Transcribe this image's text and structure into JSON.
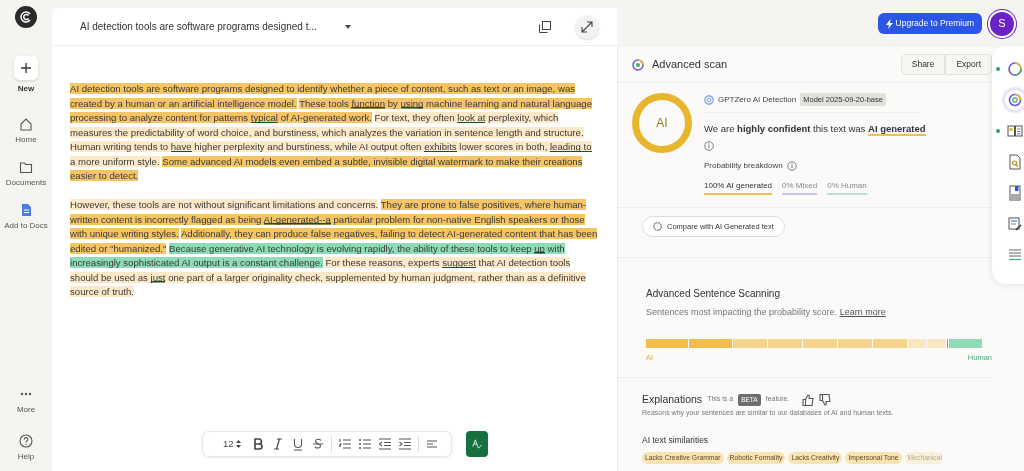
{
  "sidebar": {
    "new_label": "New",
    "items": [
      {
        "label": "Home",
        "kind": "home"
      },
      {
        "label": "Documents",
        "kind": "folder"
      },
      {
        "label": "Add to Docs",
        "kind": "doc"
      }
    ],
    "bottom_items": [
      {
        "label": "More",
        "kind": "more"
      },
      {
        "label": "Help",
        "kind": "help"
      }
    ]
  },
  "editor": {
    "title": "AI detection tools are software programs designed t...",
    "paragraphs": [
      [
        {
          "kind": "strong",
          "parts": [
            {
              "text": "AI detection tools are software programs designed to identify whether a piece of content, such as text or an image, was created by a human or an artificial intelligence model.",
              "underlined": false
            }
          ]
        },
        {
          "kind": "strong",
          "parts": [
            {
              "text": "These tools ",
              "underlined": false
            },
            {
              "text": "function",
              "underlined": true
            },
            {
              "text": " by ",
              "underlined": false
            },
            {
              "text": "using",
              "underlined": true
            },
            {
              "text": " machine learning and natural language processing to analyze content for patterns ",
              "underlined": false
            },
            {
              "text": "typical",
              "underlined": true
            },
            {
              "text": " of AI-generated work.",
              "underlined": false
            }
          ]
        },
        {
          "kind": "light",
          "parts": [
            {
              "text": "For text, they often ",
              "underlined": false
            },
            {
              "text": "look at",
              "underlined": true
            },
            {
              "text": " perplexity, which measures the predictability of word choice, and burstiness, which analyzes the variation in sentence length and structure.",
              "underlined": false
            }
          ]
        },
        {
          "kind": "light",
          "parts": [
            {
              "text": "Human writing tends to ",
              "underlined": false
            },
            {
              "text": "have",
              "underlined": true
            },
            {
              "text": " higher perplexity and burstiness, while AI output often ",
              "underlined": false
            },
            {
              "text": "exhibits",
              "underlined": true
            },
            {
              "text": " lower scores in both, ",
              "underlined": false
            },
            {
              "text": "leading to",
              "underlined": true
            },
            {
              "text": " a more uniform style.",
              "underlined": false
            }
          ]
        },
        {
          "kind": "strong",
          "parts": [
            {
              "text": "Some advanced AI models even embed a subtle, invisible digital watermark to make their creations easier to detect.",
              "underlined": false
            }
          ]
        }
      ],
      [
        {
          "kind": "light",
          "parts": [
            {
              "text": "However, these tools are not without significant limitations and concerns.",
              "underlined": false
            }
          ]
        },
        {
          "kind": "strong",
          "parts": [
            {
              "text": "They are prone to false positives, where human-written content is incorrectly flagged as being ",
              "underlined": false
            },
            {
              "text": "AI-generated--a",
              "underlined": true
            },
            {
              "text": " particular problem for non-native English speakers or those with unique writing styles.",
              "underlined": false
            }
          ]
        },
        {
          "kind": "strong",
          "parts": [
            {
              "text": "Additionally, they can produce false negatives, failing to detect AI-generated content that has been edited or \"humanized.\"",
              "underlined": false
            }
          ]
        },
        {
          "kind": "human",
          "parts": [
            {
              "text": "Because generative AI technology is evolving rapidly, the ability of these tools to keep ",
              "underlined": false
            },
            {
              "text": "up",
              "underlined": true
            },
            {
              "text": " with increasingly sophisticated AI output is a constant challenge.",
              "underlined": false
            }
          ]
        },
        {
          "kind": "light",
          "parts": [
            {
              "text": "For these reasons, experts ",
              "underlined": false
            },
            {
              "text": "suggest",
              "underlined": true
            },
            {
              "text": " that AI detection tools should be used as ",
              "underlined": false
            },
            {
              "text": "just",
              "underlined": true
            },
            {
              "text": " one part of a larger originality check, supplemented by human judgment, rather than as a definitive source of truth.",
              "underlined": false
            }
          ]
        }
      ]
    ],
    "toolbar": {
      "font_size": "12",
      "tools": [
        {
          "kind": "bold"
        },
        {
          "kind": "italic"
        },
        {
          "kind": "underline"
        },
        {
          "kind": "strike"
        },
        {
          "kind": "sep"
        },
        {
          "kind": "ordered"
        },
        {
          "kind": "bullets"
        },
        {
          "kind": "outdent"
        },
        {
          "kind": "indent"
        },
        {
          "kind": "sep"
        },
        {
          "kind": "align"
        }
      ]
    }
  },
  "top_bar": {
    "upgrade": "Upgrade to Premium",
    "avatar": "S"
  },
  "panel": {
    "title": "Advanced scan",
    "actions": [
      "Share",
      "Export"
    ],
    "result": {
      "ring_label": "AI",
      "source": "GPTZero AI Detection",
      "model": "Model 2025-09-20-base",
      "verdict": "We are **highly confident** this text was **AI generated**",
      "breakdown_label": "Probability breakdown",
      "breakdown": [
        {
          "label": "100% AI generated",
          "selected": true,
          "color": "#f0c04a"
        },
        {
          "label": "0% Mixed",
          "selected": false,
          "color": "#c9c6e6"
        },
        {
          "label": "0% Human",
          "selected": false,
          "color": "#b9e3d2"
        }
      ]
    },
    "compare": "Compare with AI Generated text",
    "scanning": {
      "title": "Advanced Sentence Scanning",
      "subtitle": "Sentences most impacting the probability score.",
      "link": "Learn more",
      "left": "AI",
      "right": "Human",
      "segments": [
        {
          "kind": "strong"
        },
        {
          "kind": "strong"
        },
        {
          "kind": "medium"
        },
        {
          "kind": "medium"
        },
        {
          "kind": "medium"
        },
        {
          "kind": "medium"
        },
        {
          "kind": "medium"
        },
        {
          "kind": "light"
        },
        {
          "kind": "light"
        },
        {
          "kind": "mixed"
        },
        {
          "kind": "human"
        }
      ]
    },
    "explanations": {
      "title": "Explanations",
      "note_before": "This is a",
      "badge": "BETA",
      "note_after": "feature.",
      "description": "Reasons why your sentences are similar to our databases of AI and human texts.",
      "similarities_title": "AI text similarities",
      "tags": [
        {
          "label": "Lacks Creative Grammar",
          "faded": false
        },
        {
          "label": "Robotic Formality",
          "faded": false
        },
        {
          "label": "Lacks Creativity",
          "faded": false
        },
        {
          "label": "Impersonal Tone",
          "faded": false
        },
        {
          "label": "Mechanical",
          "faded": true
        }
      ]
    }
  },
  "tool_rail": [
    {
      "kind": "ring",
      "selected": false,
      "notified": true
    },
    {
      "kind": "scan",
      "selected": true,
      "notified": false
    },
    {
      "kind": "compare",
      "selected": false,
      "notified": true
    },
    {
      "kind": "search-doc",
      "selected": false,
      "notified": false
    },
    {
      "kind": "bookmark-doc",
      "selected": false,
      "notified": false
    },
    {
      "kind": "edit-doc",
      "selected": false,
      "notified": false
    },
    {
      "kind": "checklist",
      "selected": false,
      "notified": false
    }
  ]
}
